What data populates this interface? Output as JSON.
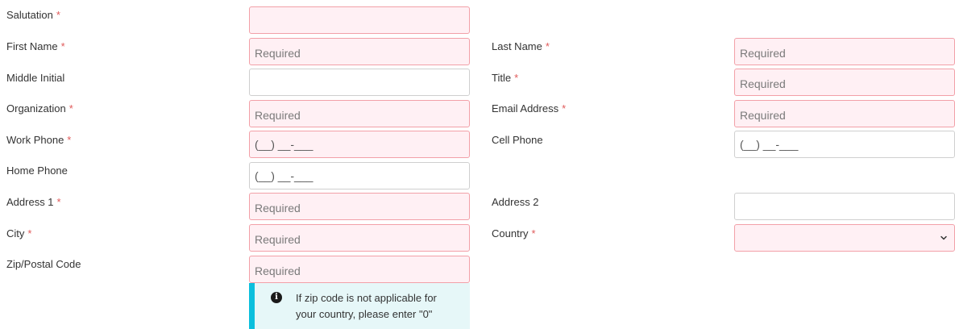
{
  "form": {
    "required_mark": "*",
    "required_placeholder": "Required",
    "phone_mask": "(__) __-___",
    "salutation": {
      "label": "Salutation",
      "value": ""
    },
    "first_name": {
      "label": "First Name"
    },
    "last_name": {
      "label": "Last Name"
    },
    "middle_initial": {
      "label": "Middle Initial",
      "value": ""
    },
    "title": {
      "label": "Title"
    },
    "organization": {
      "label": "Organization"
    },
    "email": {
      "label": "Email Address"
    },
    "work_phone": {
      "label": "Work Phone"
    },
    "cell_phone": {
      "label": "Cell Phone"
    },
    "home_phone": {
      "label": "Home Phone"
    },
    "address1": {
      "label": "Address 1"
    },
    "address2": {
      "label": "Address 2",
      "value": ""
    },
    "city": {
      "label": "City"
    },
    "country": {
      "label": "Country",
      "value": ""
    },
    "zip": {
      "label": "Zip/Postal Code"
    },
    "zip_note": {
      "icon": "info-icon",
      "text": "If zip code is not applicable for your country, please enter \"0\""
    }
  },
  "colors": {
    "required_mark": "#e05a5a",
    "required_field_bg": "#fff0f4",
    "required_field_border": "#f2a0a8",
    "note_bg": "#e6f7f8",
    "note_accent": "#0bbfdd"
  }
}
